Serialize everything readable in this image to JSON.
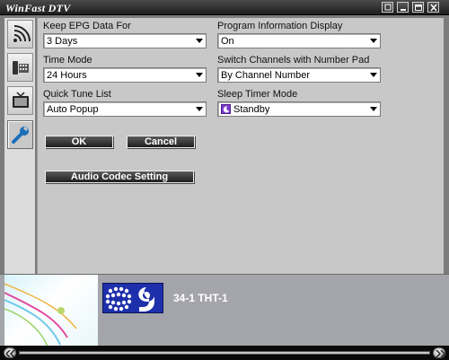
{
  "window": {
    "title": "WinFast DTV"
  },
  "sidebar": {
    "tabs": [
      {
        "name": "signal-icon"
      },
      {
        "name": "remote-icon"
      },
      {
        "name": "tv-icon"
      },
      {
        "name": "wrench-icon",
        "active": true
      }
    ]
  },
  "settings": {
    "epg": {
      "label": "Keep EPG Data For",
      "value": "3 Days"
    },
    "time_mode": {
      "label": "Time Mode",
      "value": "24 Hours"
    },
    "quick_tune": {
      "label": "Quick Tune List",
      "value": "Auto Popup"
    },
    "program_info": {
      "label": "Program Information Display",
      "value": "On"
    },
    "switch_channels": {
      "label": "Switch Channels with Number Pad",
      "value": "By Channel Number"
    },
    "sleep_timer": {
      "label": "Sleep Timer Mode",
      "value": "Standby",
      "icon": "moon-icon"
    }
  },
  "buttons": {
    "ok": "OK",
    "cancel": "Cancel",
    "audio_codec": "Audio Codec Setting"
  },
  "channel": {
    "number_name": "34-1 THT-1",
    "logo_icon": "nine-network-logo"
  },
  "colors": {
    "accent_logo": "#1d2faa",
    "standby_icon": "#7e3ad0"
  }
}
